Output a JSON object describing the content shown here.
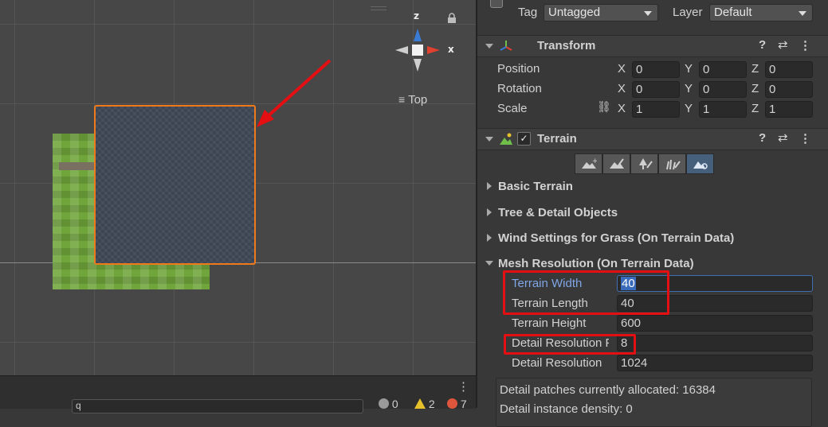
{
  "scene": {
    "view_label": "Top",
    "gizmo": {
      "z_label": "z",
      "x_label": "x"
    },
    "search_value": "q",
    "counters": [
      {
        "icon": "info-icon",
        "value": "0",
        "color": "#9a9a9a"
      },
      {
        "icon": "warning-icon",
        "value": "2",
        "color": "#e6c12b"
      },
      {
        "icon": "error-icon",
        "value": "7",
        "color": "#e0563c"
      }
    ],
    "more_label": "⋮"
  },
  "inspector": {
    "tag_label": "Tag",
    "tag_value": "Untagged",
    "layer_label": "Layer",
    "layer_value": "Default",
    "transform": {
      "title": "Transform",
      "rows": [
        {
          "label": "Position",
          "x": "0",
          "y": "0",
          "z": "0"
        },
        {
          "label": "Rotation",
          "x": "0",
          "y": "0",
          "z": "0"
        },
        {
          "label": "Scale",
          "x": "1",
          "y": "1",
          "z": "1"
        }
      ],
      "axis_x": "X",
      "axis_y": "Y",
      "axis_z": "Z"
    },
    "terrain": {
      "title": "Terrain",
      "enabled": true,
      "sections": [
        "Basic Terrain",
        "Tree & Detail Objects",
        "Wind Settings for Grass (On Terrain Data)",
        "Mesh Resolution (On Terrain Data)"
      ],
      "mesh": [
        {
          "label": "Terrain Width",
          "value": "40"
        },
        {
          "label": "Terrain Length",
          "value": "40"
        },
        {
          "label": "Terrain Height",
          "value": "600"
        },
        {
          "label": "Detail Resolution Per Patch",
          "value": "8"
        },
        {
          "label": "Detail Resolution",
          "value": "1024"
        }
      ],
      "info": [
        "Detail patches currently allocated: 16384",
        "Detail instance density: 0"
      ]
    }
  },
  "colors": {
    "selection": "#f07a1a",
    "highlight": "#e40f12",
    "active_tool": "#46607c",
    "active_label": "#7fa6e6"
  }
}
